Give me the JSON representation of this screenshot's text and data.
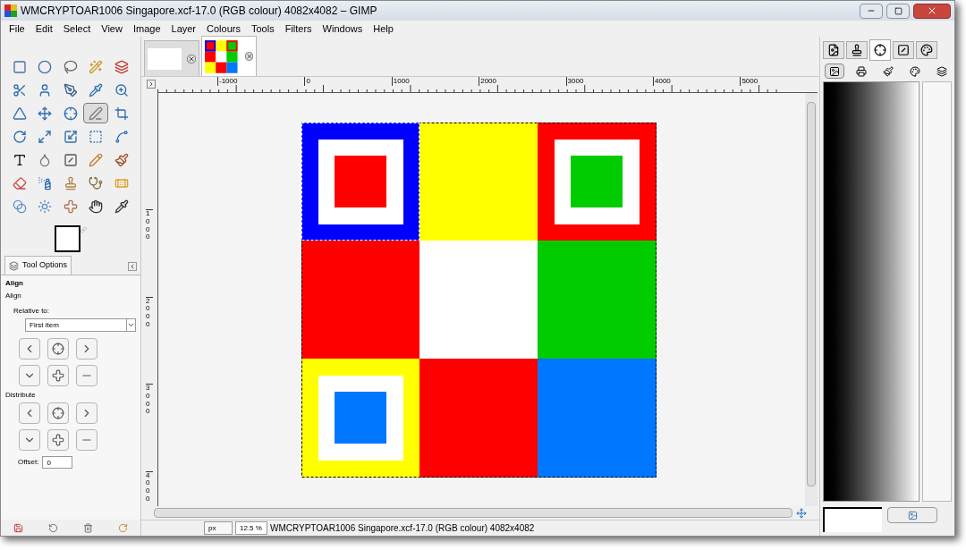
{
  "window": {
    "title": "WMCRYPTOAR1006 Singapore.xcf-17.0 (RGB colour) 4082x4082 – GIMP"
  },
  "menu": [
    "File",
    "Edit",
    "Select",
    "View",
    "Image",
    "Layer",
    "Colours",
    "Tools",
    "Filters",
    "Windows",
    "Help"
  ],
  "tools": [
    {
      "selected": false
    },
    {
      "selected": false
    },
    {
      "selected": false
    },
    {
      "selected": false
    },
    {
      "selected": false
    },
    {
      "selected": false
    },
    {
      "selected": false
    },
    {
      "selected": false
    },
    {
      "selected": false
    },
    {
      "selected": false
    },
    {
      "selected": false
    },
    {
      "selected": false
    },
    {
      "selected": false
    },
    {
      "selected": true
    },
    {
      "selected": false
    },
    {
      "selected": false
    },
    {
      "selected": false
    },
    {
      "selected": false
    },
    {
      "selected": false
    },
    {
      "selected": false
    },
    {
      "selected": false
    },
    {
      "selected": false
    },
    {
      "selected": false
    },
    {
      "selected": false
    },
    {
      "selected": false
    },
    {
      "selected": false
    },
    {
      "selected": false
    },
    {
      "selected": false
    },
    {
      "selected": false
    },
    {
      "selected": false
    },
    {
      "selected": false
    },
    {
      "selected": false
    },
    {
      "selected": false
    },
    {
      "selected": false
    },
    {
      "selected": false
    }
  ],
  "tool_options": {
    "tab": "Tool Options",
    "title": "Align",
    "section": "Align",
    "relative_label": "Relative to:",
    "relative_value": "First item",
    "distribute_label": "Distribute",
    "offset_label": "Offset:",
    "offset_value": "0"
  },
  "image_tabs": [
    {
      "selected": false
    },
    {
      "selected": true
    }
  ],
  "hruler": [
    "-1000",
    "0",
    "1000",
    "2000",
    "3000",
    "4000",
    "5000"
  ],
  "vruler": [
    "1000",
    "2000",
    "3000",
    "4000"
  ],
  "status_bar": {
    "unit": "px",
    "zoom": "12.5 %",
    "text": "WMCRYPTOAR1006 Singapore.xcf-17.0 (RGB colour) 4082x4082"
  },
  "dock_tabs": [
    {
      "selected": false
    },
    {
      "selected": false
    },
    {
      "selected": true
    },
    {
      "selected": false
    },
    {
      "selected": false
    }
  ],
  "dock_icons": [
    {
      "selected": true
    },
    {
      "selected": false
    },
    {
      "selected": false
    },
    {
      "selected": false
    },
    {
      "selected": false
    }
  ]
}
